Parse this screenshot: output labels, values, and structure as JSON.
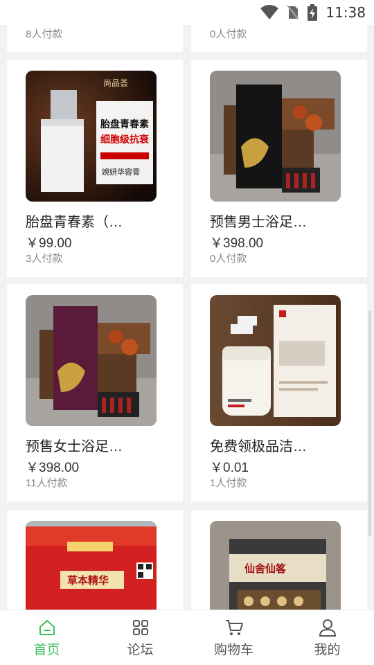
{
  "status_bar": {
    "time": "11:38"
  },
  "products": [
    {
      "title": "",
      "price": "",
      "paid": "8人付款",
      "thumb": ""
    },
    {
      "title": "",
      "price": "",
      "paid": "0人付款",
      "thumb": ""
    },
    {
      "title": "胎盘青春素（爆款）",
      "price": "￥99.00",
      "paid": "3人付款",
      "thumb": "placenta-box-image",
      "thumb_text": {
        "brand": "尚品荟",
        "line1": "胎盘青春素",
        "line2": "细胞级抗衰",
        "line3": "婉妍华容膏"
      }
    },
    {
      "title": "预售男士浴足液（草本）",
      "price": "￥398.00",
      "paid": "0人付款",
      "thumb": "herbal-foot-bath-black-box-image"
    },
    {
      "title": "预售女士浴足液（草本）",
      "price": "￥398.00",
      "paid": "11人付款",
      "thumb": "herbal-foot-bath-purple-box-image"
    },
    {
      "title": "免费领极品洁面慕斯",
      "price": "￥0.01",
      "paid": "1人付款",
      "thumb": "cleansing-mousse-image"
    },
    {
      "title": "",
      "price": "",
      "paid": "",
      "thumb": "herbal-essence-red-box-image",
      "thumb_text": {
        "label": "草本精华"
      }
    },
    {
      "title": "",
      "price": "",
      "paid": "",
      "thumb": "gift-box-vials-image",
      "thumb_text": {
        "label": "仙舍仙笿"
      }
    }
  ],
  "tabs": [
    {
      "label": "首页",
      "icon": "home-icon",
      "active": true
    },
    {
      "label": "论坛",
      "icon": "grid-icon",
      "active": false
    },
    {
      "label": "购物车",
      "icon": "cart-icon",
      "active": false
    },
    {
      "label": "我的",
      "icon": "user-icon",
      "active": false
    }
  ],
  "colors": {
    "accent": "#3bbf5e",
    "background": "#f2f2f2"
  }
}
